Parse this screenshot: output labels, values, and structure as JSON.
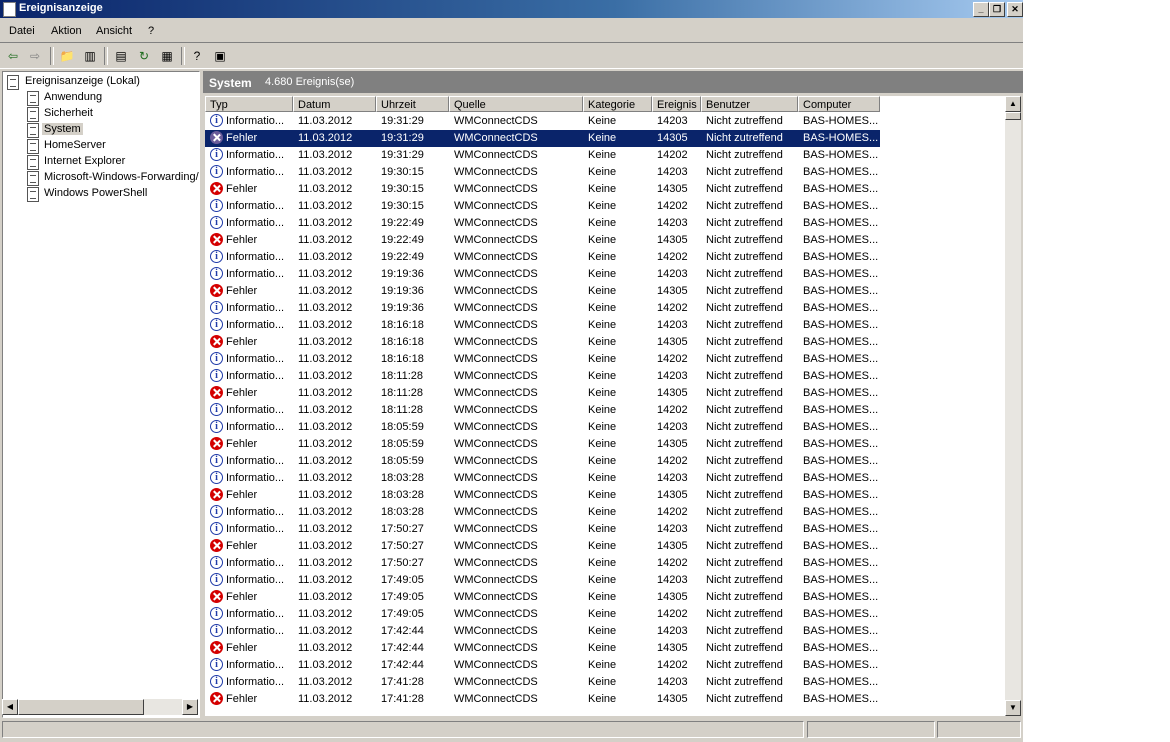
{
  "window": {
    "title": "Ereignisanzeige"
  },
  "menu": [
    "Datei",
    "Aktion",
    "Ansicht",
    "?"
  ],
  "toolbar_icons": [
    "back-icon",
    "forward-icon",
    "up-folder-icon",
    "show-hide-tree-icon",
    "properties-icon",
    "refresh-icon",
    "export-list-icon",
    "help-icon",
    "console-icon"
  ],
  "tree": {
    "root": "Ereignisanzeige (Lokal)",
    "items": [
      "Anwendung",
      "Sicherheit",
      "System",
      "HomeServer",
      "Internet Explorer",
      "Microsoft-Windows-Forwarding/",
      "Windows PowerShell"
    ],
    "selected": "System"
  },
  "panel": {
    "title": "System",
    "count": "4.680 Ereignis(se)"
  },
  "columns": [
    "Typ",
    "Datum",
    "Uhrzeit",
    "Quelle",
    "Kategorie",
    "Ereignis",
    "Benutzer",
    "Computer"
  ],
  "rows": [
    {
      "type": "Informatio...",
      "icon": "info",
      "date": "11.03.2012",
      "time": "19:31:29",
      "source": "WMConnectCDS",
      "category": "Keine",
      "event": "14203",
      "user": "Nicht zutreffend",
      "computer": "BAS-HOMES..."
    },
    {
      "type": "Fehler",
      "icon": "error",
      "date": "11.03.2012",
      "time": "19:31:29",
      "source": "WMConnectCDS",
      "category": "Keine",
      "event": "14305",
      "user": "Nicht zutreffend",
      "computer": "BAS-HOMES...",
      "selected": true
    },
    {
      "type": "Informatio...",
      "icon": "info",
      "date": "11.03.2012",
      "time": "19:31:29",
      "source": "WMConnectCDS",
      "category": "Keine",
      "event": "14202",
      "user": "Nicht zutreffend",
      "computer": "BAS-HOMES..."
    },
    {
      "type": "Informatio...",
      "icon": "info",
      "date": "11.03.2012",
      "time": "19:30:15",
      "source": "WMConnectCDS",
      "category": "Keine",
      "event": "14203",
      "user": "Nicht zutreffend",
      "computer": "BAS-HOMES..."
    },
    {
      "type": "Fehler",
      "icon": "error",
      "date": "11.03.2012",
      "time": "19:30:15",
      "source": "WMConnectCDS",
      "category": "Keine",
      "event": "14305",
      "user": "Nicht zutreffend",
      "computer": "BAS-HOMES..."
    },
    {
      "type": "Informatio...",
      "icon": "info",
      "date": "11.03.2012",
      "time": "19:30:15",
      "source": "WMConnectCDS",
      "category": "Keine",
      "event": "14202",
      "user": "Nicht zutreffend",
      "computer": "BAS-HOMES..."
    },
    {
      "type": "Informatio...",
      "icon": "info",
      "date": "11.03.2012",
      "time": "19:22:49",
      "source": "WMConnectCDS",
      "category": "Keine",
      "event": "14203",
      "user": "Nicht zutreffend",
      "computer": "BAS-HOMES..."
    },
    {
      "type": "Fehler",
      "icon": "error",
      "date": "11.03.2012",
      "time": "19:22:49",
      "source": "WMConnectCDS",
      "category": "Keine",
      "event": "14305",
      "user": "Nicht zutreffend",
      "computer": "BAS-HOMES..."
    },
    {
      "type": "Informatio...",
      "icon": "info",
      "date": "11.03.2012",
      "time": "19:22:49",
      "source": "WMConnectCDS",
      "category": "Keine",
      "event": "14202",
      "user": "Nicht zutreffend",
      "computer": "BAS-HOMES..."
    },
    {
      "type": "Informatio...",
      "icon": "info",
      "date": "11.03.2012",
      "time": "19:19:36",
      "source": "WMConnectCDS",
      "category": "Keine",
      "event": "14203",
      "user": "Nicht zutreffend",
      "computer": "BAS-HOMES..."
    },
    {
      "type": "Fehler",
      "icon": "error",
      "date": "11.03.2012",
      "time": "19:19:36",
      "source": "WMConnectCDS",
      "category": "Keine",
      "event": "14305",
      "user": "Nicht zutreffend",
      "computer": "BAS-HOMES..."
    },
    {
      "type": "Informatio...",
      "icon": "info",
      "date": "11.03.2012",
      "time": "19:19:36",
      "source": "WMConnectCDS",
      "category": "Keine",
      "event": "14202",
      "user": "Nicht zutreffend",
      "computer": "BAS-HOMES..."
    },
    {
      "type": "Informatio...",
      "icon": "info",
      "date": "11.03.2012",
      "time": "18:16:18",
      "source": "WMConnectCDS",
      "category": "Keine",
      "event": "14203",
      "user": "Nicht zutreffend",
      "computer": "BAS-HOMES..."
    },
    {
      "type": "Fehler",
      "icon": "error",
      "date": "11.03.2012",
      "time": "18:16:18",
      "source": "WMConnectCDS",
      "category": "Keine",
      "event": "14305",
      "user": "Nicht zutreffend",
      "computer": "BAS-HOMES..."
    },
    {
      "type": "Informatio...",
      "icon": "info",
      "date": "11.03.2012",
      "time": "18:16:18",
      "source": "WMConnectCDS",
      "category": "Keine",
      "event": "14202",
      "user": "Nicht zutreffend",
      "computer": "BAS-HOMES..."
    },
    {
      "type": "Informatio...",
      "icon": "info",
      "date": "11.03.2012",
      "time": "18:11:28",
      "source": "WMConnectCDS",
      "category": "Keine",
      "event": "14203",
      "user": "Nicht zutreffend",
      "computer": "BAS-HOMES..."
    },
    {
      "type": "Fehler",
      "icon": "error",
      "date": "11.03.2012",
      "time": "18:11:28",
      "source": "WMConnectCDS",
      "category": "Keine",
      "event": "14305",
      "user": "Nicht zutreffend",
      "computer": "BAS-HOMES..."
    },
    {
      "type": "Informatio...",
      "icon": "info",
      "date": "11.03.2012",
      "time": "18:11:28",
      "source": "WMConnectCDS",
      "category": "Keine",
      "event": "14202",
      "user": "Nicht zutreffend",
      "computer": "BAS-HOMES..."
    },
    {
      "type": "Informatio...",
      "icon": "info",
      "date": "11.03.2012",
      "time": "18:05:59",
      "source": "WMConnectCDS",
      "category": "Keine",
      "event": "14203",
      "user": "Nicht zutreffend",
      "computer": "BAS-HOMES..."
    },
    {
      "type": "Fehler",
      "icon": "error",
      "date": "11.03.2012",
      "time": "18:05:59",
      "source": "WMConnectCDS",
      "category": "Keine",
      "event": "14305",
      "user": "Nicht zutreffend",
      "computer": "BAS-HOMES..."
    },
    {
      "type": "Informatio...",
      "icon": "info",
      "date": "11.03.2012",
      "time": "18:05:59",
      "source": "WMConnectCDS",
      "category": "Keine",
      "event": "14202",
      "user": "Nicht zutreffend",
      "computer": "BAS-HOMES..."
    },
    {
      "type": "Informatio...",
      "icon": "info",
      "date": "11.03.2012",
      "time": "18:03:28",
      "source": "WMConnectCDS",
      "category": "Keine",
      "event": "14203",
      "user": "Nicht zutreffend",
      "computer": "BAS-HOMES..."
    },
    {
      "type": "Fehler",
      "icon": "error",
      "date": "11.03.2012",
      "time": "18:03:28",
      "source": "WMConnectCDS",
      "category": "Keine",
      "event": "14305",
      "user": "Nicht zutreffend",
      "computer": "BAS-HOMES..."
    },
    {
      "type": "Informatio...",
      "icon": "info",
      "date": "11.03.2012",
      "time": "18:03:28",
      "source": "WMConnectCDS",
      "category": "Keine",
      "event": "14202",
      "user": "Nicht zutreffend",
      "computer": "BAS-HOMES..."
    },
    {
      "type": "Informatio...",
      "icon": "info",
      "date": "11.03.2012",
      "time": "17:50:27",
      "source": "WMConnectCDS",
      "category": "Keine",
      "event": "14203",
      "user": "Nicht zutreffend",
      "computer": "BAS-HOMES..."
    },
    {
      "type": "Fehler",
      "icon": "error",
      "date": "11.03.2012",
      "time": "17:50:27",
      "source": "WMConnectCDS",
      "category": "Keine",
      "event": "14305",
      "user": "Nicht zutreffend",
      "computer": "BAS-HOMES..."
    },
    {
      "type": "Informatio...",
      "icon": "info",
      "date": "11.03.2012",
      "time": "17:50:27",
      "source": "WMConnectCDS",
      "category": "Keine",
      "event": "14202",
      "user": "Nicht zutreffend",
      "computer": "BAS-HOMES..."
    },
    {
      "type": "Informatio...",
      "icon": "info",
      "date": "11.03.2012",
      "time": "17:49:05",
      "source": "WMConnectCDS",
      "category": "Keine",
      "event": "14203",
      "user": "Nicht zutreffend",
      "computer": "BAS-HOMES..."
    },
    {
      "type": "Fehler",
      "icon": "error",
      "date": "11.03.2012",
      "time": "17:49:05",
      "source": "WMConnectCDS",
      "category": "Keine",
      "event": "14305",
      "user": "Nicht zutreffend",
      "computer": "BAS-HOMES..."
    },
    {
      "type": "Informatio...",
      "icon": "info",
      "date": "11.03.2012",
      "time": "17:49:05",
      "source": "WMConnectCDS",
      "category": "Keine",
      "event": "14202",
      "user": "Nicht zutreffend",
      "computer": "BAS-HOMES..."
    },
    {
      "type": "Informatio...",
      "icon": "info",
      "date": "11.03.2012",
      "time": "17:42:44",
      "source": "WMConnectCDS",
      "category": "Keine",
      "event": "14203",
      "user": "Nicht zutreffend",
      "computer": "BAS-HOMES..."
    },
    {
      "type": "Fehler",
      "icon": "error",
      "date": "11.03.2012",
      "time": "17:42:44",
      "source": "WMConnectCDS",
      "category": "Keine",
      "event": "14305",
      "user": "Nicht zutreffend",
      "computer": "BAS-HOMES..."
    },
    {
      "type": "Informatio...",
      "icon": "info",
      "date": "11.03.2012",
      "time": "17:42:44",
      "source": "WMConnectCDS",
      "category": "Keine",
      "event": "14202",
      "user": "Nicht zutreffend",
      "computer": "BAS-HOMES..."
    },
    {
      "type": "Informatio...",
      "icon": "info",
      "date": "11.03.2012",
      "time": "17:41:28",
      "source": "WMConnectCDS",
      "category": "Keine",
      "event": "14203",
      "user": "Nicht zutreffend",
      "computer": "BAS-HOMES..."
    },
    {
      "type": "Fehler",
      "icon": "error",
      "date": "11.03.2012",
      "time": "17:41:28",
      "source": "WMConnectCDS",
      "category": "Keine",
      "event": "14305",
      "user": "Nicht zutreffend",
      "computer": "BAS-HOMES..."
    }
  ],
  "colors": {
    "title_bar": "#0a246a",
    "selection": "#0a246a",
    "error": "#d40000",
    "info": "#1f3aa8",
    "panel_header": "#808080"
  }
}
